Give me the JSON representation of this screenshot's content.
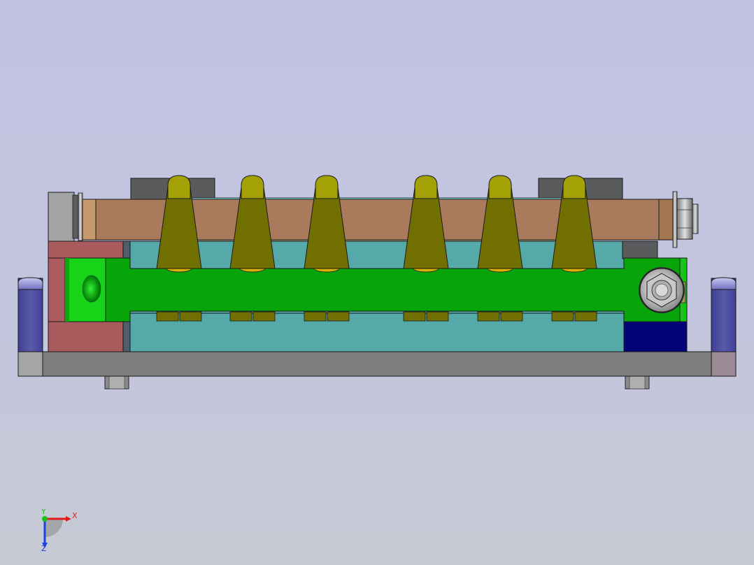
{
  "viewport": {
    "background_top": "#c1c2e2",
    "background_bottom": "#c6cad4"
  },
  "model": {
    "colors": {
      "base_plate": "#7d7d7d",
      "side_block": "#5a5aa6",
      "back_block": "#ab5b5e",
      "teal_body": "#55a9a8",
      "pale_top": "#9fa37f",
      "cyan_edge": "#8be6ea",
      "dark_block": "#5a5b5d",
      "brown_shaft": "#a97b5c",
      "green_bar": "#07a50a",
      "bright_green": "#17d418",
      "olive_pin": "#716f00",
      "olive_pin_top": "#a3a106",
      "navy_block": "#020379",
      "nut": "#b9b9b9"
    },
    "pin_count": 6
  },
  "triad": {
    "x_label": "X",
    "y_label": "Y",
    "z_label": "Z",
    "x_color": "#e02020",
    "y_color": "#18c018",
    "z_color": "#2040e0"
  }
}
